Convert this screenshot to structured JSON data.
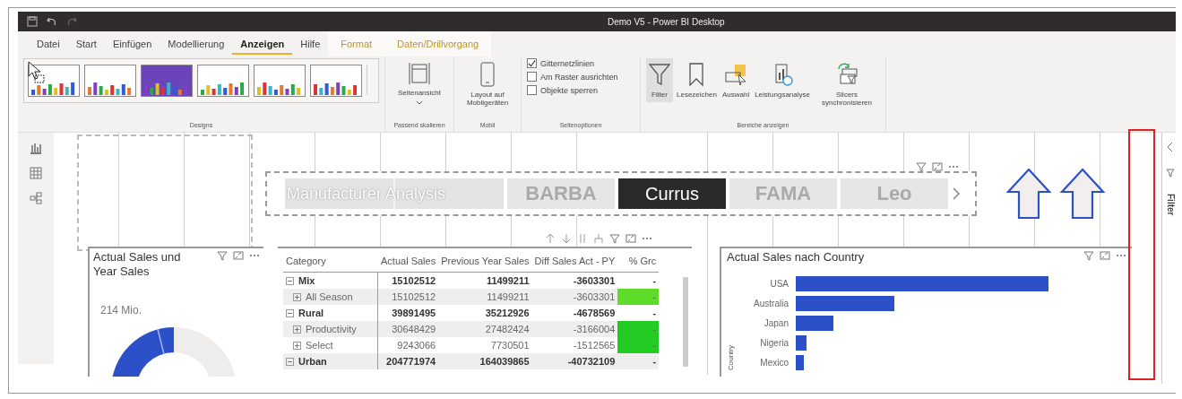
{
  "window": {
    "title": "Demo V5 - Power BI Desktop"
  },
  "ribbon_tabs": [
    {
      "label": "Datei",
      "kind": "normal",
      "selected": false
    },
    {
      "label": "Start",
      "kind": "normal",
      "selected": false
    },
    {
      "label": "Einfügen",
      "kind": "normal",
      "selected": false
    },
    {
      "label": "Modellierung",
      "kind": "normal",
      "selected": false
    },
    {
      "label": "Anzeigen",
      "kind": "normal",
      "selected": true
    },
    {
      "label": "Hilfe",
      "kind": "normal",
      "selected": false
    },
    {
      "label": "Format",
      "kind": "context",
      "selected": false
    },
    {
      "label": "Daten/Drillvorgang",
      "kind": "context",
      "selected": false
    }
  ],
  "designs": {
    "group": "Designs",
    "themes": [
      {
        "color": "#ffffff"
      },
      {
        "color": "#ffffff"
      },
      {
        "color": "#6a44b8"
      },
      {
        "color": "#ffffff"
      },
      {
        "color": "#ffffff"
      },
      {
        "color": "#ffffff"
      }
    ]
  },
  "scale": {
    "label": "Seitenansicht",
    "group": "Passend skalieren"
  },
  "mobile": {
    "label": "Layout auf Mobilgeräten",
    "group": "Mobil"
  },
  "page_options": {
    "group": "Seitenoptionen",
    "items": [
      {
        "label": "Gitternetzlinien",
        "checked": true
      },
      {
        "label": "Am Raster ausrichten",
        "checked": false
      },
      {
        "label": "Objekte sperren",
        "checked": false
      }
    ]
  },
  "panes": {
    "group": "Bereiche anzeigen",
    "buttons": [
      {
        "label": "Filter",
        "kind": "filter",
        "selected": true
      },
      {
        "label": "Lesezeichen",
        "kind": "bookmark",
        "selected": false
      },
      {
        "label": "Auswahl",
        "kind": "selection",
        "selected": false
      },
      {
        "label": "Leistungsanalyse",
        "kind": "performance",
        "selected": false
      },
      {
        "label": "Slicers synchronisieren",
        "kind": "sync",
        "selected": false
      }
    ]
  },
  "filter_pane": {
    "label": "Filter"
  },
  "slicer": {
    "title": "Manufacturer Analysis",
    "logos": [
      {
        "label": "BARBA",
        "kind": "light"
      },
      {
        "label": "Currus",
        "kind": "dark"
      },
      {
        "label": "FAMA",
        "kind": "light"
      },
      {
        "label": "Leo",
        "kind": "light"
      }
    ]
  },
  "donut": {
    "title": "Actual Sales und Year Sales",
    "value": "214 Mio."
  },
  "matrix": {
    "columns": [
      "Category",
      "Actual Sales",
      "Previous Year Sales",
      "Diff Sales Act - PY",
      "% Grc"
    ],
    "rows": [
      {
        "label": "Mix",
        "expanded": true,
        "values": [
          "15102512",
          "11499211",
          "-3603301"
        ],
        "growth": "-",
        "children": [
          {
            "label": "All Season",
            "expanded": false,
            "values": [
              "15102512",
              "11499211",
              "-3603301"
            ],
            "growth": "-",
            "color": "#5fdc2a"
          }
        ]
      },
      {
        "label": "Rural",
        "expanded": true,
        "values": [
          "39891495",
          "35212926",
          "-4678569"
        ],
        "growth": "-",
        "children": [
          {
            "label": "Productivity",
            "expanded": false,
            "values": [
              "30648429",
              "27482424",
              "-3166004"
            ],
            "growth": "-",
            "color": "#22cc22"
          },
          {
            "label": "Select",
            "expanded": false,
            "values": [
              "9243066",
              "7730501",
              "-1512565"
            ],
            "growth": "-",
            "color": "#22cc22"
          }
        ]
      },
      {
        "label": "Urban",
        "expanded": true,
        "values": [
          "204771974",
          "164039865",
          "-40732109"
        ],
        "growth": "-"
      }
    ]
  },
  "bar_chart": {
    "title": "Actual Sales nach Country",
    "axis_label": "Country",
    "categories": [
      "USA",
      "Australia",
      "Japan",
      "Nigeria",
      "Mexico"
    ]
  }
}
